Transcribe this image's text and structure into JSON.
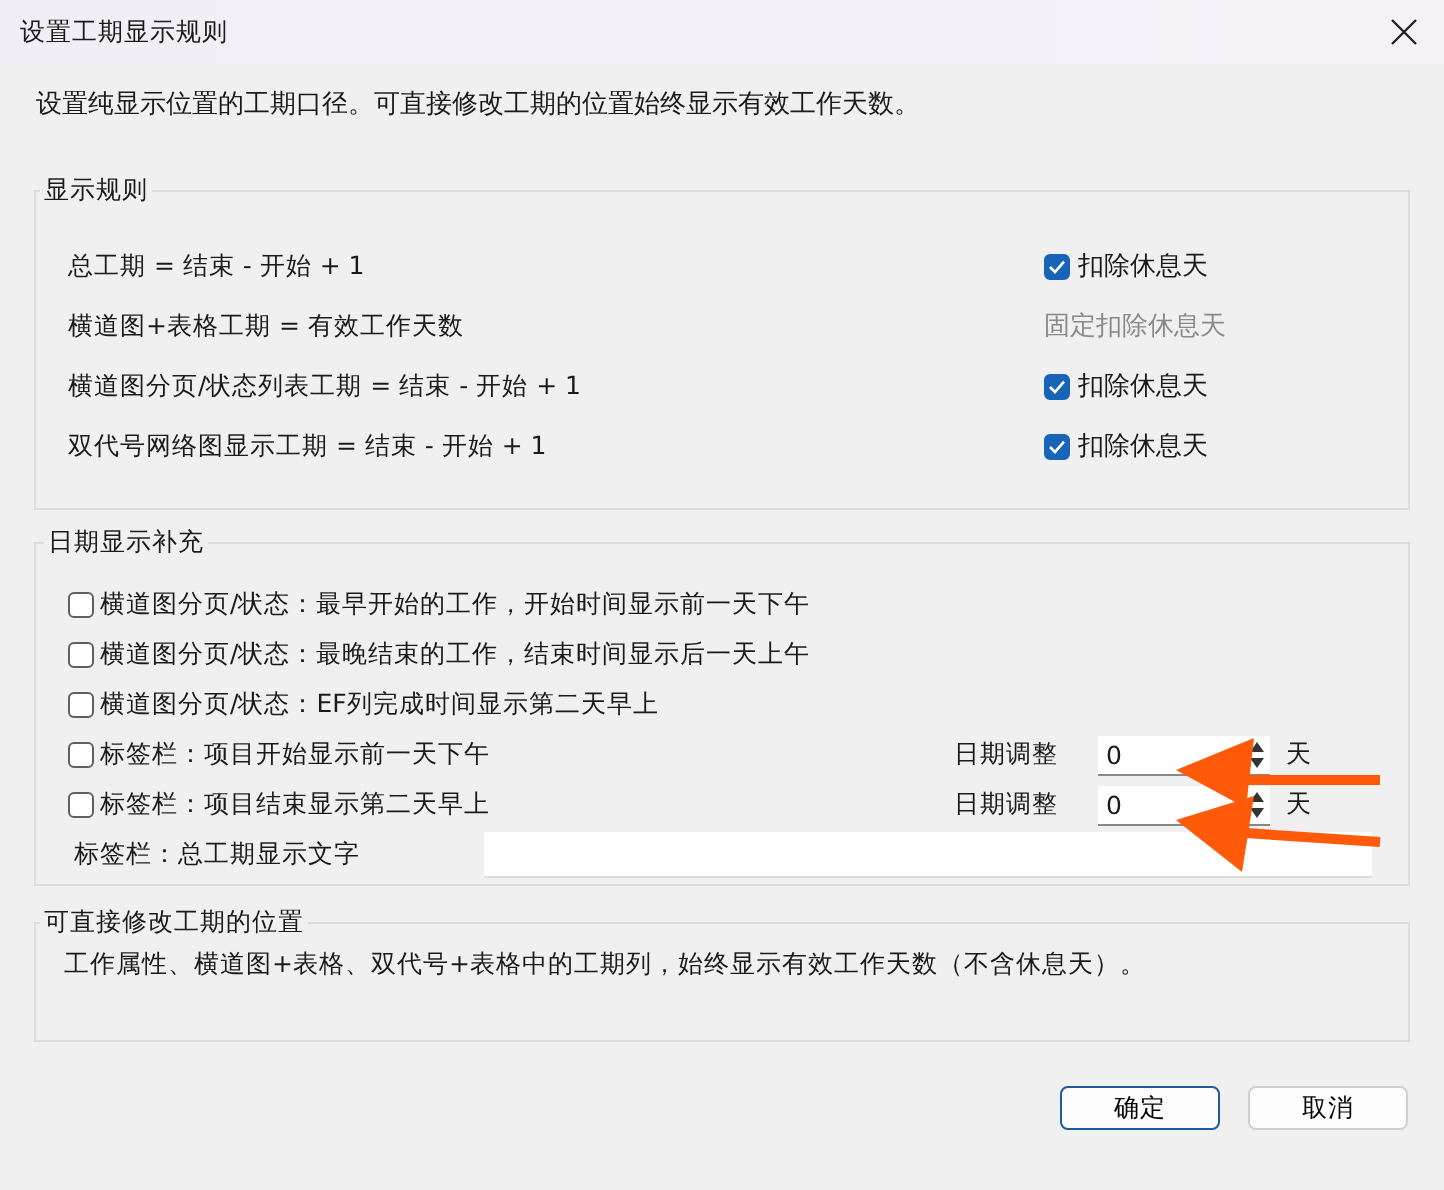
{
  "window": {
    "title": "设置工期显示规则"
  },
  "intro": "设置纯显示位置的工期口径。可直接修改工期的位置始终显示有效工作天数。",
  "display_rules": {
    "title": "显示规则",
    "rows": [
      {
        "label": "总工期 = 结束 - 开始 + 1",
        "kind": "checkbox",
        "option": "扣除休息天",
        "checked": true
      },
      {
        "label": "横道图+表格工期 = 有效工作天数",
        "kind": "fixed",
        "option": "固定扣除休息天"
      },
      {
        "label": "横道图分页/状态列表工期 = 结束 - 开始 + 1",
        "kind": "checkbox",
        "option": "扣除休息天",
        "checked": true
      },
      {
        "label": "双代号网络图显示工期 = 结束 - 开始 + 1",
        "kind": "checkbox",
        "option": "扣除休息天",
        "checked": true
      }
    ]
  },
  "date_supplement": {
    "title": "日期显示补充",
    "rows": [
      {
        "kind": "checkbox",
        "label": "横道图分页/状态：最早开始的工作，开始时间显示前一天下午",
        "checked": false
      },
      {
        "kind": "checkbox",
        "label": "横道图分页/状态：最晚结束的工作，结束时间显示后一天上午",
        "checked": false
      },
      {
        "kind": "checkbox",
        "label": "横道图分页/状态：EF列完成时间显示第二天早上",
        "checked": false
      },
      {
        "kind": "adjust",
        "label": "标签栏：项目开始显示前一天下午",
        "checked": false,
        "adjust_label": "日期调整",
        "value": "0",
        "unit": "天"
      },
      {
        "kind": "adjust",
        "label": "标签栏：项目结束显示第二天早上",
        "checked": false,
        "adjust_label": "日期调整",
        "value": "0",
        "unit": "天"
      },
      {
        "kind": "text",
        "label": "标签栏：总工期显示文字"
      }
    ]
  },
  "editable_positions": {
    "title": "可直接修改工期的位置",
    "text": "工作属性、横道图+表格、双代号+表格中的工期列，始终显示有效工作天数（不含休息天）。"
  },
  "buttons": [
    {
      "label": "确定",
      "default": true
    },
    {
      "label": "取消",
      "default": false
    }
  ]
}
